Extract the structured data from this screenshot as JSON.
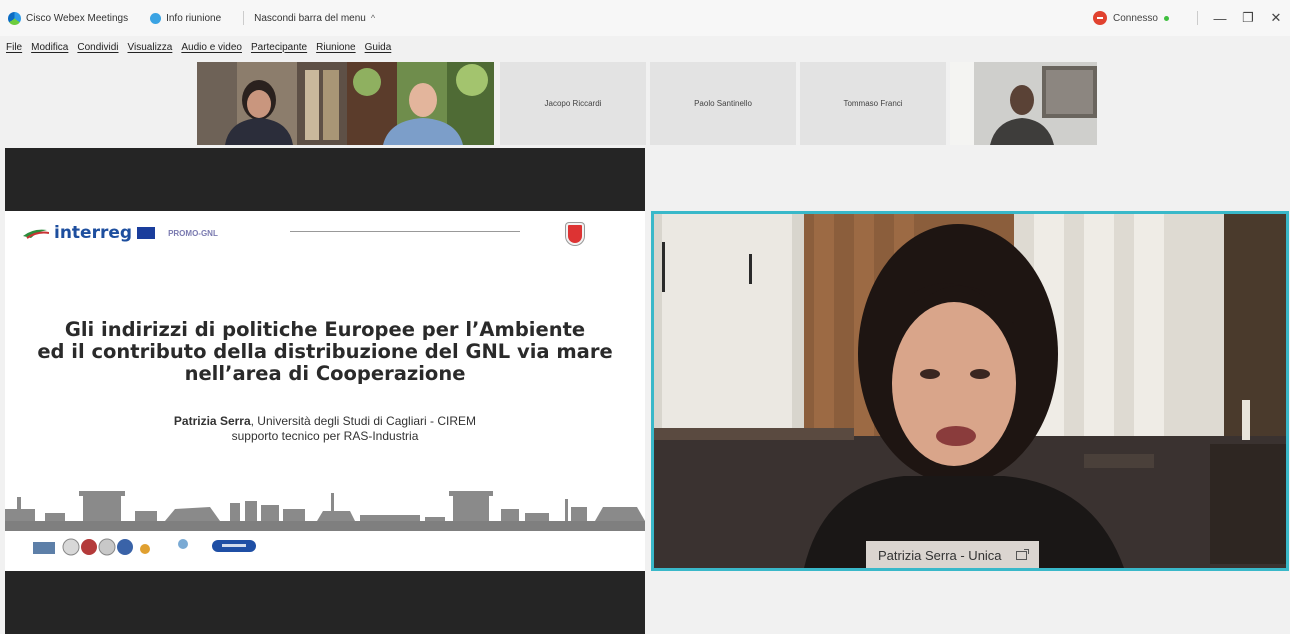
{
  "titlebar": {
    "app_name": "Cisco Webex Meetings",
    "info_label": "Info riunione",
    "hide_menu_label": "Nascondi barra del menu",
    "hide_menu_chevron": "^",
    "connected_label": "Connesso",
    "minimize": "—",
    "restore": "❐",
    "close": "✕"
  },
  "menubar": {
    "items": [
      "File",
      "Modifica",
      "Condividi",
      "Visualizza",
      "Audio e video",
      "Partecipante",
      "Riunione",
      "Guida"
    ]
  },
  "participants": {
    "names": [
      "Jacopo Riccardi",
      "Paolo Santinello",
      "Tommaso Franci"
    ]
  },
  "slide": {
    "brand": "interreg",
    "project": "PROMO-GNL",
    "title_line1": "Gli indirizzi di politiche Europee per l’Ambiente",
    "title_line2": "ed il contributo della distribuzione del GNL via mare",
    "title_line3": "nell’area di Cooperazione",
    "author_name": "Patrizia Serra",
    "author_affiliation": ", Università degli Studi di Cagliari - CIREM",
    "author_role": "supporto tecnico per RAS-Industria"
  },
  "active_speaker": {
    "name_tag": "Patrizia Serra - Unica",
    "highlight_color": "#39b8c9"
  },
  "colors": {
    "webex_red": "#e1422f",
    "interreg_blue": "#1d4e9e"
  }
}
